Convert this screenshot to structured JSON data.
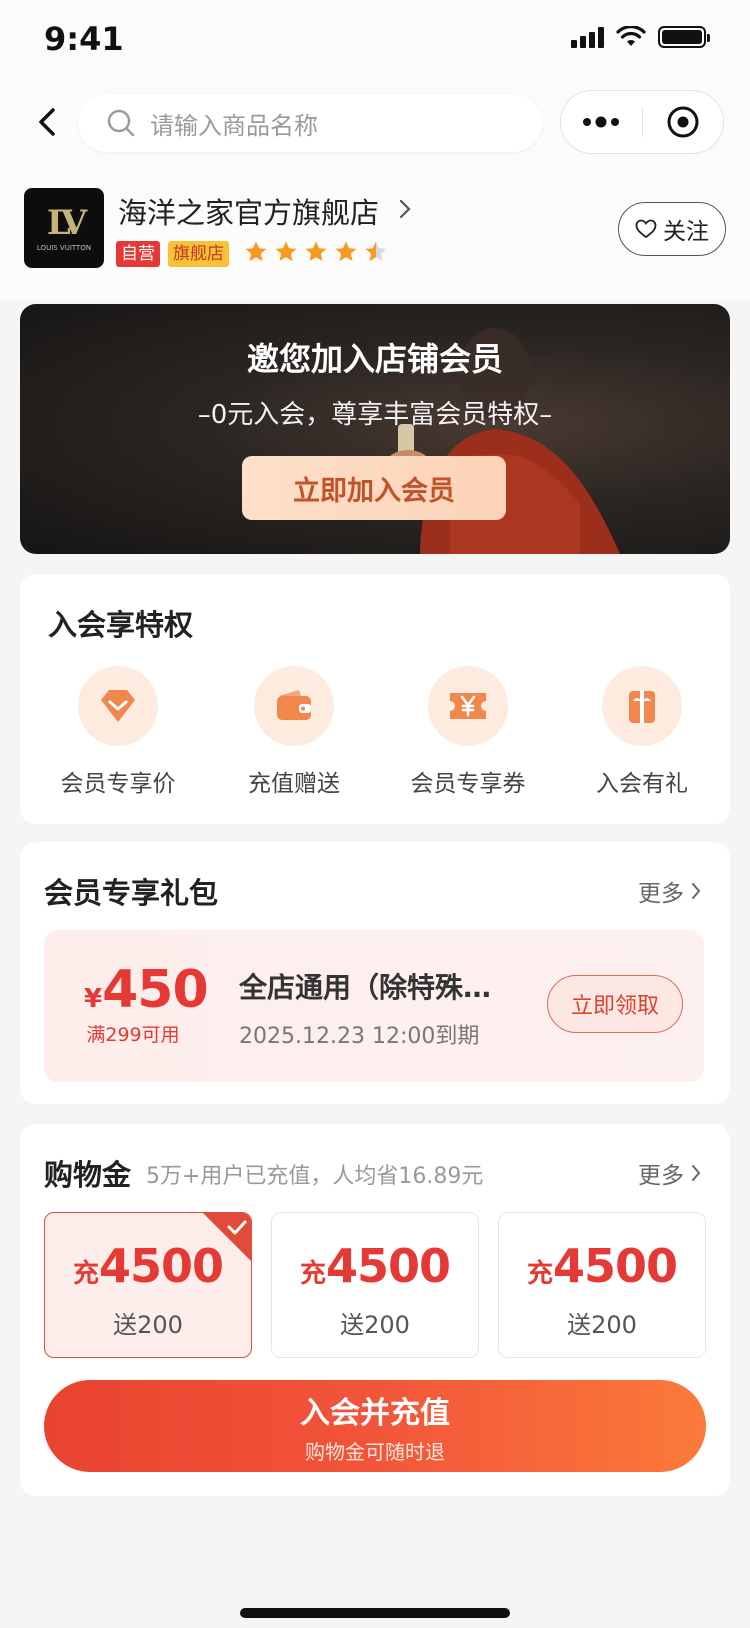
{
  "status": {
    "time": "9:41"
  },
  "nav": {
    "search_placeholder": "请输入商品名称"
  },
  "store": {
    "name": "海洋之家官方旗舰店",
    "tags": [
      "自营",
      "旗舰店"
    ],
    "rating": 4.5,
    "follow_label": "关注",
    "logo_text": "LOUIS VUITTON"
  },
  "banner": {
    "title": "邀您加入店铺会员",
    "subtitle": "–0元入会，尊享丰富会员特权–",
    "button": "立即加入会员"
  },
  "privileges": {
    "title": "入会享特权",
    "items": [
      {
        "label": "会员专享价",
        "icon": "diamond-icon"
      },
      {
        "label": "充值赠送",
        "icon": "wallet-icon"
      },
      {
        "label": "会员专享券",
        "icon": "yen-coupon-icon"
      },
      {
        "label": "入会有礼",
        "icon": "gift-icon"
      }
    ]
  },
  "gift_pack": {
    "title": "会员专享礼包",
    "more": "更多",
    "coupon": {
      "currency": "¥",
      "amount": "450",
      "condition": "满299可用",
      "title": "全店通用（除特殊商品外）",
      "expiry": "2025.12.23 12:00到期",
      "button": "立即领取"
    }
  },
  "wallet": {
    "title": "购物金",
    "subtitle": "5万+用户已充值，人均省16.89元",
    "more": "更多",
    "options": [
      {
        "prefix": "充",
        "amount": "4500",
        "gift": "送200",
        "selected": true
      },
      {
        "prefix": "充",
        "amount": "4500",
        "gift": "送200",
        "selected": false
      },
      {
        "prefix": "充",
        "amount": "4500",
        "gift": "送200",
        "selected": false
      }
    ],
    "button": {
      "label": "入会并充值",
      "sub": "购物金可随时退"
    }
  },
  "colors": {
    "accent": "#e53935",
    "banner_button_text": "#c0532b",
    "privilege_icon_bg": "#fdebe0",
    "privilege_icon": "#f0884e",
    "tag_flag_bg": "#f8c136",
    "star": "#f79a1f"
  }
}
